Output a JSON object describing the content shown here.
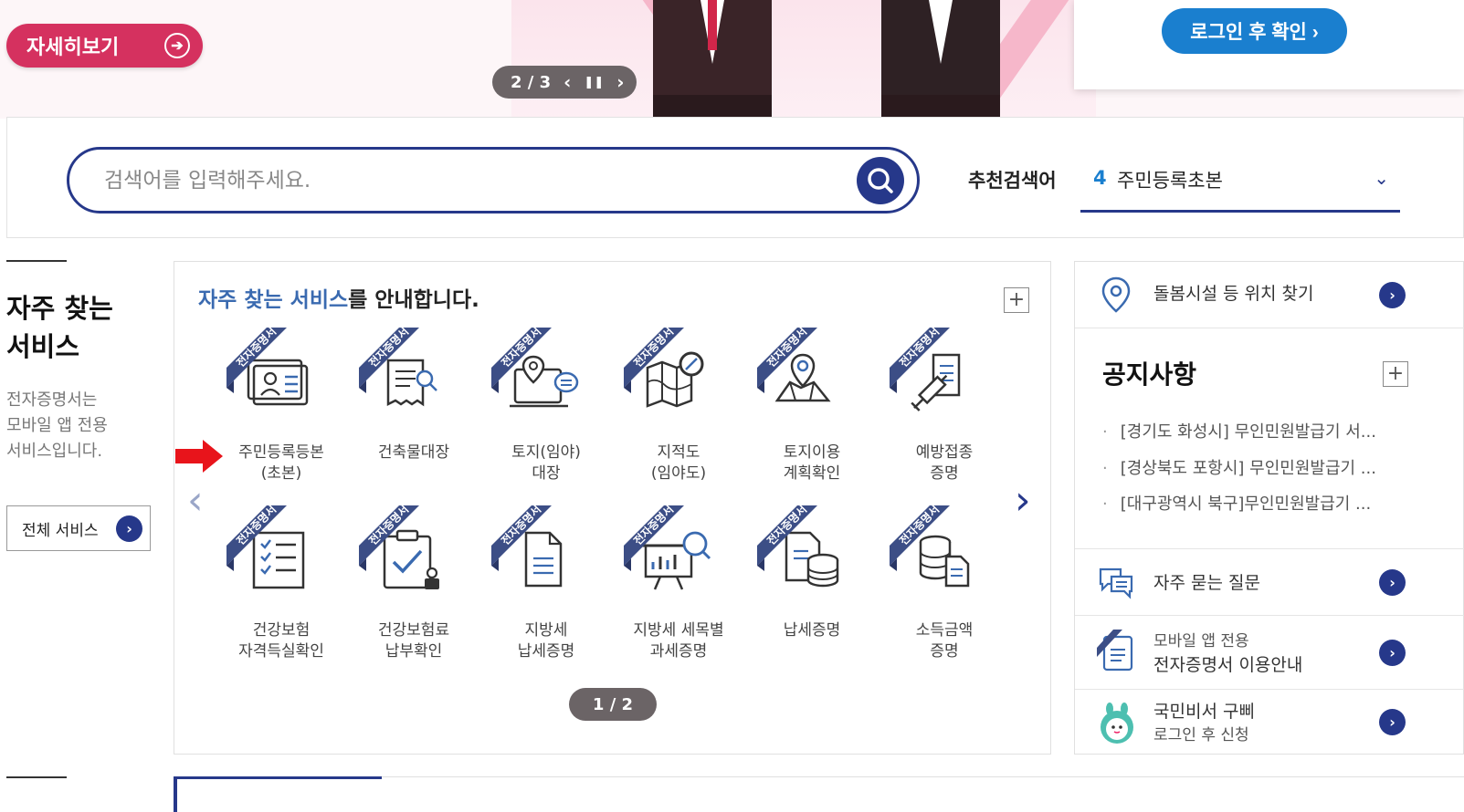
{
  "banner": {
    "detail_label": "자세히보기",
    "slide_current": "2",
    "slide_total": "3",
    "login_check_label": "로그인 후 확인 ›"
  },
  "search": {
    "placeholder": "검색어를 입력해주세요.",
    "recommend_label": "추천검색어",
    "recommend_rank": "4",
    "recommend_term": "주민등록초본"
  },
  "frequent": {
    "title_line1": "자주 찾는",
    "title_line2": "서비스",
    "desc_line1": "전자증명서는",
    "desc_line2": "모바일 앱 전용",
    "desc_line3": "서비스입니다.",
    "all_services_label": "전체 서비스"
  },
  "services": {
    "heading_highlight": "자주 찾는 서비스",
    "heading_rest": "를 안내합니다.",
    "badge_text": "전자증명서",
    "items": [
      {
        "line1": "주민등록등본",
        "line2": "(초본)",
        "icon": "id-card-icon"
      },
      {
        "line1": "건축물대장",
        "line2": "",
        "icon": "building-document-icon"
      },
      {
        "line1": "토지(임야)",
        "line2": "대장",
        "icon": "land-map-icon"
      },
      {
        "line1": "지적도",
        "line2": "(임야도)",
        "icon": "folded-map-icon"
      },
      {
        "line1": "토지이용",
        "line2": "계획확인",
        "icon": "location-map-icon"
      },
      {
        "line1": "예방접종",
        "line2": "증명",
        "icon": "vaccine-icon"
      },
      {
        "line1": "건강보험",
        "line2": "자격득실확인",
        "icon": "checklist-icon"
      },
      {
        "line1": "건강보험료",
        "line2": "납부확인",
        "icon": "clipboard-stamp-icon"
      },
      {
        "line1": "지방세",
        "line2": "납세증명",
        "icon": "tax-document-icon"
      },
      {
        "line1": "지방세 세목별",
        "line2": "과세증명",
        "icon": "presentation-chart-icon"
      },
      {
        "line1": "납세증명",
        "line2": "",
        "icon": "document-coins-icon"
      },
      {
        "line1": "소득금액",
        "line2": "증명",
        "icon": "coins-document-icon"
      }
    ],
    "page_current": "1",
    "page_total": "2"
  },
  "right": {
    "care_label": "돌봄시설 등 위치 찾기",
    "notice_title": "공지사항",
    "notices": [
      "[경기도 화성시] 무인민원발급기 서...",
      "[경상북도 포항시] 무인민원발급기 ...",
      "[대구광역시 북구]무인민원발급기 ..."
    ],
    "faq_label": "자주 묻는 질문",
    "mobile_line1": "모바일 앱 전용",
    "mobile_line2": "전자증명서 이용안내",
    "gubbe_line1": "국민비서 구삐",
    "gubbe_line2": "로그인 후 신청"
  },
  "colors": {
    "navy": "#26388a",
    "pink": "#d5315f",
    "blue": "#1a7fcf"
  }
}
